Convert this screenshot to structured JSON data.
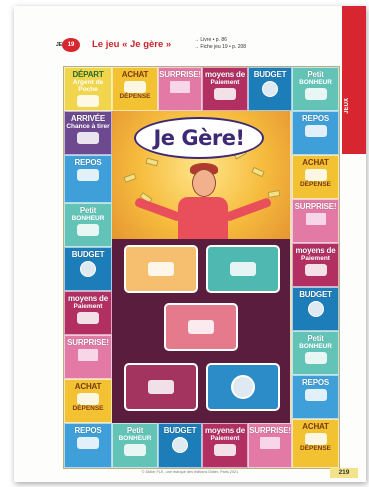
{
  "side_tab": {
    "label": "JEUX"
  },
  "header": {
    "jeu_prefix": "JEU",
    "jeu_number": "19",
    "title": "Le jeu « Je gère »",
    "refs": [
      "→ Livre • p. 86",
      "→ Fiche jeu 19 • p. 208"
    ]
  },
  "board": {
    "center_title": "Je Gère!",
    "cells": {
      "depart": {
        "label": "DÉPART",
        "sub": "Argent de Poche"
      },
      "arrivee": {
        "label": "ARRIVÉE",
        "sub": "Chance à tirer"
      },
      "achat": {
        "label": "ACHAT",
        "sub": "DÉPENSE"
      },
      "repos": {
        "label": "REPOS"
      },
      "bonheur": {
        "label": "Petit",
        "sub": "BONHEUR"
      },
      "budget": {
        "label": "BUDGET"
      },
      "moyens": {
        "label": "moyens de",
        "sub": "Paiement"
      },
      "surprise": {
        "label": "SURPRISE!"
      }
    }
  },
  "colors": {
    "accent": "#d7262f",
    "center_panel": "#5b1d3d",
    "card_orange": "#f6bf6f",
    "card_teal": "#4fb8b0",
    "card_pink": "#e47a8b",
    "card_plum": "#a3345f",
    "card_blue": "#2c8cc7"
  },
  "footer": {
    "copyright": "© Didier FLE, une marque des éditions Didier, Paris 2021"
  },
  "page_number": "219"
}
